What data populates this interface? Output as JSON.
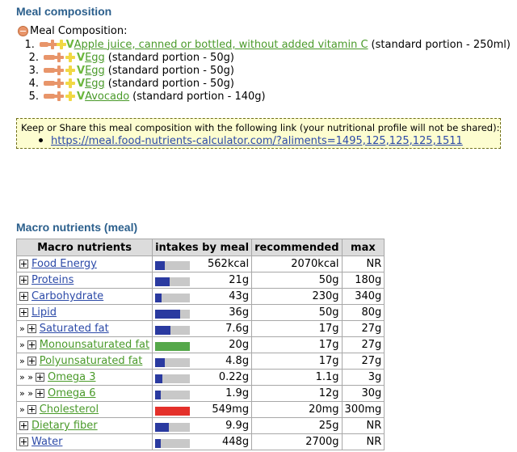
{
  "meal_heading": "Meal composition",
  "composition_label": "Meal Composition:",
  "items": [
    {
      "num": "1.",
      "name": "Apple juice, canned or bottled, without added vitamin C",
      "portion": "(standard portion - 250ml)"
    },
    {
      "num": "2.",
      "name": "Egg",
      "portion": "(standard portion - 50g)"
    },
    {
      "num": "3.",
      "name": "Egg",
      "portion": "(standard portion - 50g)"
    },
    {
      "num": "4.",
      "name": "Egg",
      "portion": "(standard portion - 50g)"
    },
    {
      "num": "5.",
      "name": "Avocado",
      "portion": "(standard portion - 140g)"
    }
  ],
  "share": {
    "text": "Keep or Share this meal composition with the following link (your nutritional profile will not be shared):",
    "link": "https://meal.food-nutrients-calculator.com/?aliments=1495,125,125,125,1511"
  },
  "macro_heading": "Macro nutrients (meal)",
  "table": {
    "headers": [
      "Macro nutrients",
      "intakes by meal",
      "recommended",
      "max"
    ],
    "rows": [
      {
        "prefix": "",
        "name": "Food Energy",
        "link": "blue",
        "fill": 0.27,
        "color": "#2a3aa0",
        "intake": "562kcal",
        "recommended": "2070kcal",
        "max": "NR"
      },
      {
        "prefix": "",
        "name": "Proteins",
        "link": "blue",
        "fill": 0.42,
        "color": "#2a3aa0",
        "intake": "21g",
        "recommended": "50g",
        "max": "180g"
      },
      {
        "prefix": "",
        "name": "Carbohydrate",
        "link": "blue",
        "fill": 0.19,
        "color": "#2a3aa0",
        "intake": "43g",
        "recommended": "230g",
        "max": "340g"
      },
      {
        "prefix": "",
        "name": "Lipid",
        "link": "blue",
        "fill": 0.72,
        "color": "#2a3aa0",
        "intake": "36g",
        "recommended": "50g",
        "max": "80g"
      },
      {
        "prefix": "»",
        "name": "Saturated fat",
        "link": "blue",
        "fill": 0.45,
        "color": "#2a3aa0",
        "intake": "7.6g",
        "recommended": "17g",
        "max": "27g"
      },
      {
        "prefix": "»",
        "name": "Monounsaturated fat",
        "link": "green",
        "fill": 1.0,
        "color": "#55a84a",
        "intake": "20g",
        "recommended": "17g",
        "max": "27g"
      },
      {
        "prefix": "»",
        "name": "Polyunsaturated fat",
        "link": "green",
        "fill": 0.28,
        "color": "#2a3aa0",
        "intake": "4.8g",
        "recommended": "17g",
        "max": "27g"
      },
      {
        "prefix": "» »",
        "name": "Omega 3",
        "link": "green",
        "fill": 0.2,
        "color": "#2a3aa0",
        "intake": "0.22g",
        "recommended": "1.1g",
        "max": "3g"
      },
      {
        "prefix": "» »",
        "name": "Omega 6",
        "link": "green",
        "fill": 0.16,
        "color": "#2a3aa0",
        "intake": "1.9g",
        "recommended": "12g",
        "max": "30g"
      },
      {
        "prefix": "»",
        "name": "Cholesterol",
        "link": "green",
        "fill": 1.0,
        "color": "#e4302a",
        "intake": "549mg",
        "recommended": "20mg",
        "max": "300mg"
      },
      {
        "prefix": "",
        "name": "Dietary fiber",
        "link": "green",
        "fill": 0.4,
        "color": "#2a3aa0",
        "intake": "9.9g",
        "recommended": "25g",
        "max": "NR"
      },
      {
        "prefix": "",
        "name": "Water",
        "link": "blue",
        "fill": 0.17,
        "color": "#2a3aa0",
        "intake": "448g",
        "recommended": "2700g",
        "max": "NR"
      }
    ]
  }
}
